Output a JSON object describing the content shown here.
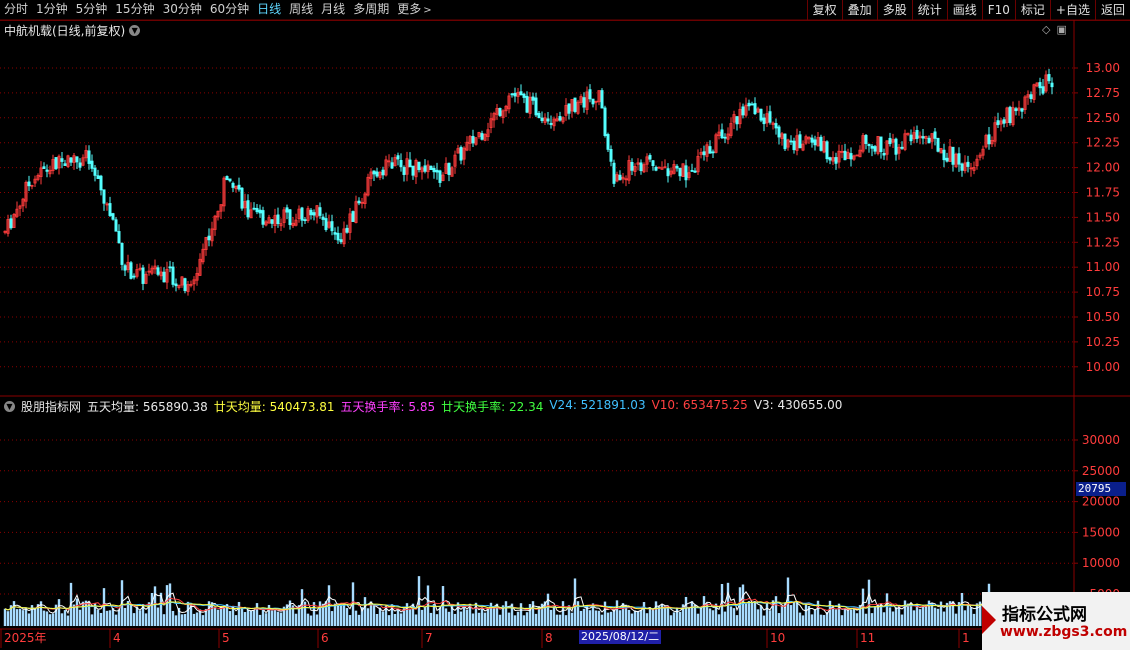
{
  "toolbar": {
    "periods": [
      "分时",
      "1分钟",
      "5分钟",
      "15分钟",
      "30分钟",
      "60分钟",
      "日线",
      "周线",
      "月线",
      "多周期",
      "更多"
    ],
    "active": "日线",
    "right_buttons": [
      "复权",
      "叠加",
      "多股",
      "统计",
      "画线",
      "F10",
      "标记",
      "+自选",
      "返回"
    ]
  },
  "main_chart": {
    "title": "中航机载(日线,前复权)",
    "price_axis_labels": [
      "13.00",
      "12.75",
      "12.50",
      "12.25",
      "12.00",
      "11.75",
      "11.50",
      "11.25",
      "11.00",
      "10.75",
      "10.50",
      "10.25",
      "10.00"
    ]
  },
  "indicator": {
    "name": "股朋指标网",
    "items": [
      {
        "label": "五天均量:",
        "value": "565890.38",
        "color": "#e8e8e8"
      },
      {
        "label": "廿天均量:",
        "value": "540473.81",
        "color": "#ffff40"
      },
      {
        "label": "五天换手率:",
        "value": "5.85",
        "color": "#ff40ff"
      },
      {
        "label": "廿天换手率:",
        "value": "22.34",
        "color": "#40ff40"
      },
      {
        "label": "V24:",
        "value": "521891.03",
        "color": "#40c0ff"
      },
      {
        "label": "V10:",
        "value": "653475.25",
        "color": "#ff4040"
      },
      {
        "label": "V3:",
        "value": "430655.00",
        "color": "#e8e8e8"
      }
    ],
    "axis_labels": [
      "30000",
      "25000",
      "20000",
      "15000",
      "10000",
      "5000"
    ],
    "current_value": "20795"
  },
  "date_axis": {
    "labels": [
      "2025年",
      "4",
      "5",
      "6",
      "7",
      "8",
      "10",
      "11",
      "1"
    ],
    "highlighted_date": "2025/08/12/二"
  },
  "watermark": {
    "title": "指标公式网",
    "url": "www.zbgs3.com"
  },
  "colors": {
    "up": "#ff3c3c",
    "down": "#54ffff",
    "grid": "#8a0000",
    "axis_text": "#ff3c3c"
  }
}
